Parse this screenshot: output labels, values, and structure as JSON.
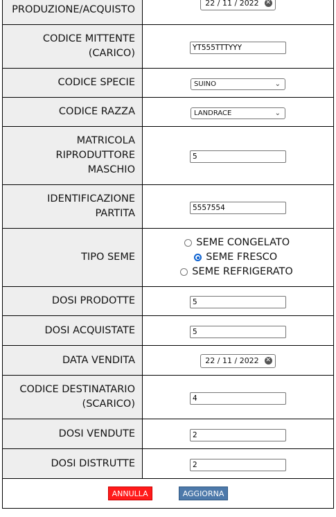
{
  "rows": {
    "produzione": {
      "label": "PRODUZIONE/ACQUISTO",
      "date": "22 / 11 / 2022"
    },
    "codice_mittente": {
      "label": "CODICE MITTENTE (CARICO)",
      "value": "YT555TTTYYY"
    },
    "codice_specie": {
      "label": "CODICE SPECIE",
      "selected": "SUINO"
    },
    "codice_razza": {
      "label": "CODICE RAZZA",
      "selected": "LANDRACE"
    },
    "matricola": {
      "label": "MATRICOLA RIPRODUTTORE MASCHIO",
      "value": "5"
    },
    "identificazione": {
      "label": "IDENTIFICAZIONE PARTITA",
      "value": "5557554"
    },
    "tipo_seme": {
      "label": "TIPO SEME",
      "options": [
        {
          "label": "SEME CONGELATO",
          "checked": false
        },
        {
          "label": "SEME FRESCO",
          "checked": true
        },
        {
          "label": "SEME REFRIGERATO",
          "checked": false
        }
      ]
    },
    "dosi_prodotte": {
      "label": "DOSI PRODOTTE",
      "value": "5"
    },
    "dosi_acquistate": {
      "label": "DOSI ACQUISTATE",
      "value": "5"
    },
    "data_vendita": {
      "label": "DATA VENDITA",
      "date": "22 / 11 / 2022"
    },
    "codice_destinatario": {
      "label": "CODICE DESTINATARIO (SCARICO)",
      "value": "4"
    },
    "dosi_vendute": {
      "label": "DOSI VENDUTE",
      "value": "2"
    },
    "dosi_distrutte": {
      "label": "DOSI DISTRUTTE",
      "value": "2"
    }
  },
  "icons": {
    "select_arrow": "chevron-down-icon",
    "date_clear": "clear-icon",
    "radio": "radio-icon"
  },
  "buttons": {
    "annulla": "ANNULLA",
    "aggiorna": "AGGIORNA"
  },
  "colors": {
    "annulla_bg": "#ff1a1a",
    "aggiorna_bg": "#4d79aa",
    "radio_accent": "#0a60d0",
    "label_bg": "#eeeeee"
  }
}
